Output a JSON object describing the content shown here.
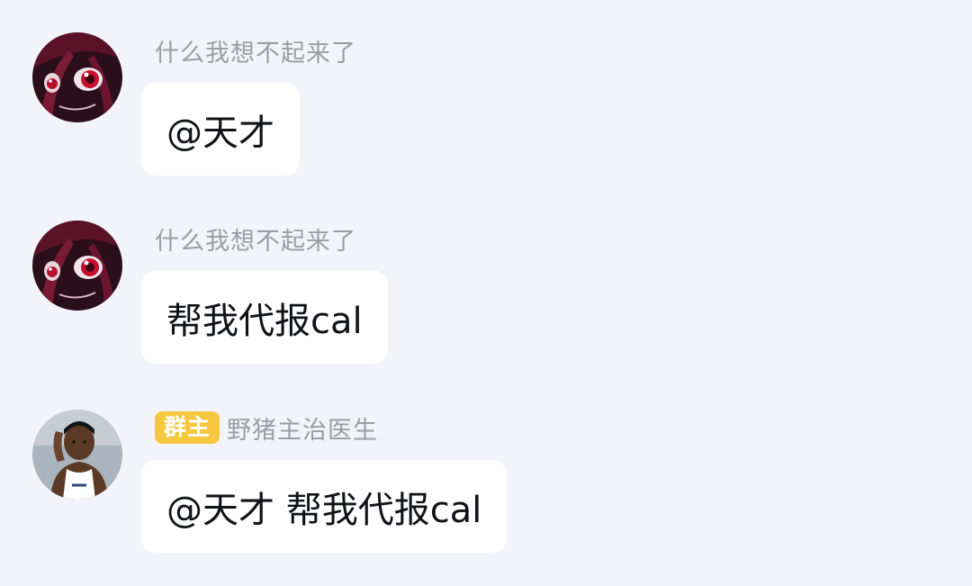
{
  "messages": [
    {
      "sender": "什么我想不起来了",
      "text": "@天才",
      "avatar_icon": "anime-girl-red-eyes-avatar"
    },
    {
      "sender": "什么我想不起来了",
      "text": "帮我代报cal",
      "avatar_icon": "anime-girl-red-eyes-avatar"
    },
    {
      "badge": "群主",
      "sender": "野猪主治医生",
      "text": "@天才 帮我代报cal",
      "avatar_icon": "basketball-player-avatar"
    }
  ],
  "colors": {
    "background": "#f3f4f9",
    "bubble": "#ffffff",
    "sender_name": "#9b9da3",
    "badge": "#f6c840",
    "message_text": "#111318"
  }
}
